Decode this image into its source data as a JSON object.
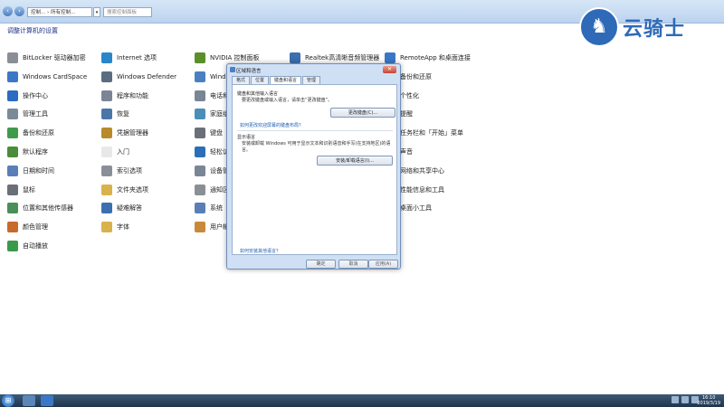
{
  "address": {
    "crumbs": "控制... › 所有控制...",
    "search_placeholder": "搜索控制面板"
  },
  "page_heading": "调整计算机的设置",
  "columns": [
    {
      "items": [
        {
          "label": "BitLocker 驱动器加密",
          "icon": "bitlocker-icon",
          "color": "#8a8f97"
        },
        {
          "label": "Windows CardSpace",
          "icon": "cardspace-icon",
          "color": "#3a78c7"
        },
        {
          "label": "操作中心",
          "icon": "action-center-icon",
          "color": "#2b6bc2"
        },
        {
          "label": "管理工具",
          "icon": "admin-tools-icon",
          "color": "#7b8a98"
        },
        {
          "label": "备份和还原",
          "icon": "backup-icon",
          "color": "#3f9a4c"
        },
        {
          "label": "默认程序",
          "icon": "default-programs-icon",
          "color": "#4b8c3a"
        },
        {
          "label": "日期和时间",
          "icon": "clock-icon",
          "color": "#5a7fb8"
        },
        {
          "label": "鼠标",
          "icon": "mouse-icon",
          "color": "#6a6f78"
        },
        {
          "label": "位置和其他传感器",
          "icon": "sensor-icon",
          "color": "#4a8f5a"
        },
        {
          "label": "颜色管理",
          "icon": "color-icon",
          "color": "#c86a2a"
        },
        {
          "label": "自动播放",
          "icon": "autoplay-icon",
          "color": "#3a9a4a"
        }
      ]
    },
    {
      "items": [
        {
          "label": "Internet 选项",
          "icon": "internet-icon",
          "color": "#2a86c9"
        },
        {
          "label": "Windows Defender",
          "icon": "defender-icon",
          "color": "#5b6d80"
        },
        {
          "label": "程序和功能",
          "icon": "programs-icon",
          "color": "#7a8595"
        },
        {
          "label": "恢复",
          "icon": "recovery-icon",
          "color": "#4a76a8"
        },
        {
          "label": "凭据管理器",
          "icon": "credentials-icon",
          "color": "#b88a2a"
        },
        {
          "label": "入门",
          "icon": "getting-started-icon",
          "color": "#e8e8e8"
        },
        {
          "label": "索引选项",
          "icon": "index-icon",
          "color": "#8a8f97"
        },
        {
          "label": "文件夹选项",
          "icon": "folder-icon",
          "color": "#d8b24a"
        },
        {
          "label": "疑难解答",
          "icon": "troubleshoot-icon",
          "color": "#3a6fb0"
        },
        {
          "label": "字体",
          "icon": "fonts-icon",
          "color": "#d8b24a"
        }
      ]
    },
    {
      "items": [
        {
          "label": "NVIDIA 控制面板",
          "icon": "nvidia-icon",
          "color": "#5a8f2a"
        },
        {
          "label": "Wind",
          "icon": "windows-icon",
          "color": "#4a7fc0"
        },
        {
          "label": "电话和",
          "icon": "phone-icon",
          "color": "#7a8595"
        },
        {
          "label": "家庭组",
          "icon": "homegroup-icon",
          "color": "#4a8fb8"
        },
        {
          "label": "键盘",
          "icon": "keyboard-icon",
          "color": "#6a6f78"
        },
        {
          "label": "轻松访",
          "icon": "ease-access-icon",
          "color": "#2a6fb8"
        },
        {
          "label": "设备管",
          "icon": "device-manager-icon",
          "color": "#7a8595"
        },
        {
          "label": "通知区",
          "icon": "notification-icon",
          "color": "#8a8f97"
        },
        {
          "label": "系统",
          "icon": "system-icon",
          "color": "#5a7fb8"
        },
        {
          "label": "用户帐",
          "icon": "user-accounts-icon",
          "color": "#c88a3a"
        }
      ]
    },
    {
      "items": [
        {
          "label": "Realtek高清晰音频管理器",
          "icon": "realtek-icon",
          "color": "#3a6fb0"
        }
      ]
    },
    {
      "items": [
        {
          "label": "RemoteApp 和桌面连接",
          "icon": "remoteapp-icon",
          "color": "#3a78c7"
        },
        {
          "label": "备份和还原",
          "icon": "backup2-icon",
          "color": "#3f9a4c"
        },
        {
          "label": "个性化",
          "icon": "personalize-icon",
          "color": "#c86a9a"
        },
        {
          "label": "提醒",
          "icon": "alert-icon",
          "color": "#8a8f97"
        },
        {
          "label": "任务栏和「开始」菜单",
          "icon": "taskbar-icon",
          "color": "#4a7fc0"
        },
        {
          "label": "声音",
          "icon": "sound-icon",
          "color": "#7a8595"
        },
        {
          "label": "网络和共享中心",
          "icon": "network-icon",
          "color": "#3a78c7"
        },
        {
          "label": "性能信息和工具",
          "icon": "performance-icon",
          "color": "#4a8f5a"
        },
        {
          "label": "桌面小工具",
          "icon": "gadgets-icon",
          "color": "#5a7fb8"
        }
      ]
    }
  ],
  "logo": {
    "text": "云骑士"
  },
  "dialog": {
    "title": "区域和语言",
    "close": "✕",
    "tabs": [
      "格式",
      "位置",
      "键盘和语言",
      "管理"
    ],
    "keyboard_group_title": "键盘和其他输入语言",
    "keyboard_text": "要更改键盘或输入语言，请单击“更改键盘”。",
    "change_keyboard_btn": "更改键盘(C)...",
    "keyboard_link": "如何更改欢迎屏幕的键盘布局？",
    "display_group_title": "显示语言",
    "display_text": "安装或卸载 Windows 可用于显示文本和识别语音和手写(在支持地区)的语言。",
    "install_btn": "安装/卸载语言(I)...",
    "bottom_link": "如何安装其他语言？",
    "ok_btn": "确定",
    "cancel_btn": "取消",
    "apply_btn": "应用(A)"
  },
  "taskbar": {
    "time": "16:10",
    "date": "2019/3/19"
  }
}
